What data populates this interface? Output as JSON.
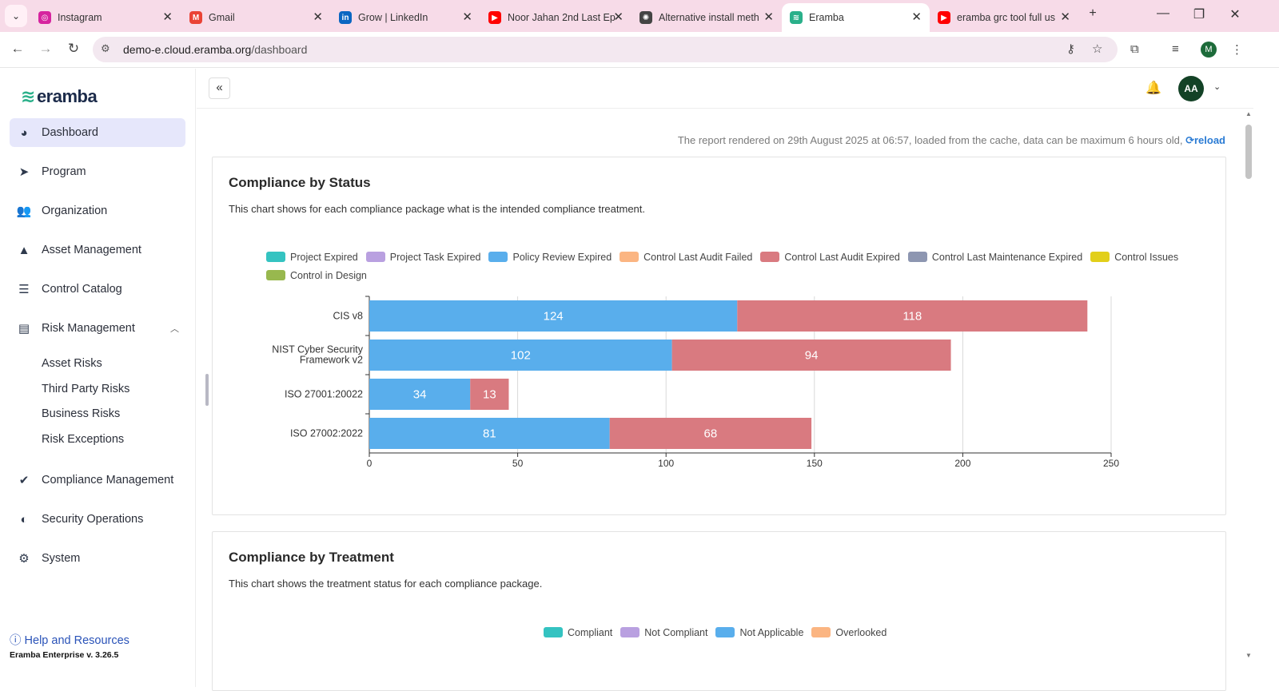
{
  "browser": {
    "tabs": [
      {
        "title": "Instagram",
        "color": "#d6249f",
        "glyph": "◎"
      },
      {
        "title": "Gmail",
        "color": "#ea4335",
        "glyph": "M"
      },
      {
        "title": "Grow | LinkedIn",
        "color": "#0a66c2",
        "glyph": "in"
      },
      {
        "title": "Noor Jahan 2nd Last Ep",
        "color": "#ff0000",
        "glyph": "▶"
      },
      {
        "title": "Alternative install meth",
        "color": "#444444",
        "glyph": "✺"
      },
      {
        "title": "Eramba",
        "color": "#2ab08a",
        "glyph": "≋"
      },
      {
        "title": "eramba grc tool full us",
        "color": "#ff0000",
        "glyph": "▶"
      }
    ],
    "url_host": "demo-e.cloud.eramba.org",
    "url_path": "/dashboard",
    "profile_initial": "M"
  },
  "sidebar": {
    "logo": "eramba",
    "items": [
      {
        "label": "Dashboard",
        "icon": "dashboard-icon",
        "glyph": "◕"
      },
      {
        "label": "Program",
        "icon": "send-icon",
        "glyph": "➤"
      },
      {
        "label": "Organization",
        "icon": "people-icon",
        "glyph": "👥"
      },
      {
        "label": "Asset Management",
        "icon": "shapes-icon",
        "glyph": "▲"
      },
      {
        "label": "Control Catalog",
        "icon": "sliders-icon",
        "glyph": "☰"
      },
      {
        "label": "Risk Management",
        "icon": "list-icon",
        "glyph": "▤"
      },
      {
        "label": "Compliance Management",
        "icon": "check-badge-icon",
        "glyph": "✔"
      },
      {
        "label": "Security Operations",
        "icon": "shield-icon",
        "glyph": "◐"
      },
      {
        "label": "System",
        "icon": "gear-icon",
        "glyph": "⚙"
      }
    ],
    "risk_sub_items": [
      "Asset Risks",
      "Third Party Risks",
      "Business Risks",
      "Risk Exceptions"
    ],
    "help": "Help and Resources",
    "version": "Eramba Enterprise v. 3.26.5"
  },
  "header": {
    "avatar_initials": "AA"
  },
  "notice": {
    "text": "The report rendered on 29th August 2025 at 06:57, loaded from the cache, data can be maximum 6 hours old,",
    "reload": "reload"
  },
  "status_card": {
    "title": "Compliance by Status",
    "description": "This chart shows for each compliance package what is the intended compliance treatment.",
    "legend": [
      {
        "label": "Project Expired",
        "color": "#34c3c1"
      },
      {
        "label": "Project Task Expired",
        "color": "#b9a0e0"
      },
      {
        "label": "Policy Review Expired",
        "color": "#59aeec"
      },
      {
        "label": "Control Last Audit Failed",
        "color": "#fbb582"
      },
      {
        "label": "Control Last Audit Expired",
        "color": "#d97a80"
      },
      {
        "label": "Control Last Maintenance Expired",
        "color": "#8d96b1"
      },
      {
        "label": "Control Issues",
        "color": "#e2cf1a"
      },
      {
        "label": "Control in Design",
        "color": "#98b84e"
      }
    ]
  },
  "treatment_card": {
    "title": "Compliance by Treatment",
    "description": "This chart shows the treatment status for each compliance package.",
    "legend": [
      {
        "label": "Compliant",
        "color": "#34c3c1"
      },
      {
        "label": "Not Compliant",
        "color": "#b9a0e0"
      },
      {
        "label": "Not Applicable",
        "color": "#59aeec"
      },
      {
        "label": "Overlooked",
        "color": "#fbb582"
      }
    ]
  },
  "chart_data": {
    "type": "bar",
    "orientation": "horizontal",
    "stacked": true,
    "title": "Compliance by Status",
    "categories": [
      "CIS v8",
      "NIST Cyber Security Framework v2",
      "ISO 27001:20022",
      "ISO 27002:2022"
    ],
    "series": [
      {
        "name": "Policy Review Expired",
        "color": "#59aeec",
        "values": [
          124,
          102,
          34,
          81
        ]
      },
      {
        "name": "Control Last Audit Expired",
        "color": "#d97a80",
        "values": [
          118,
          94,
          13,
          68
        ]
      }
    ],
    "xlim": [
      0,
      250
    ],
    "xticks": [
      0,
      50,
      100,
      150,
      200,
      250
    ],
    "grid": true,
    "legend_position": "top"
  }
}
